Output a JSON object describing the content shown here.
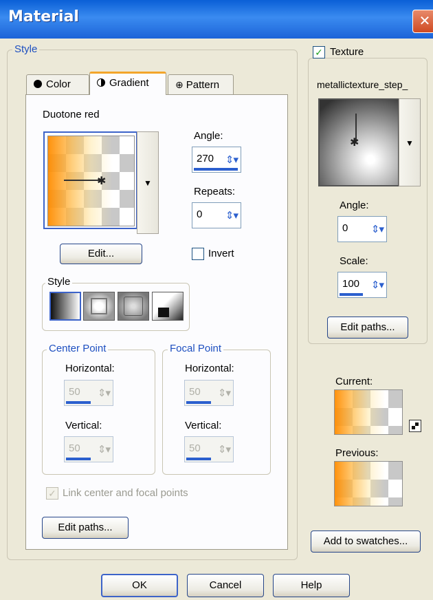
{
  "window": {
    "title": "Material",
    "close_glyph": "✕"
  },
  "style_group": {
    "label": "Style"
  },
  "tabs": [
    {
      "label": "Color",
      "icon": "color-dot-icon"
    },
    {
      "label": "Gradient",
      "icon": "gradient-half-icon"
    },
    {
      "label": "Pattern",
      "icon": "pattern-icon"
    }
  ],
  "gradient": {
    "name": "Duotone red",
    "angle_label": "Angle:",
    "angle_value": "270",
    "repeats_label": "Repeats:",
    "repeats_value": "0",
    "edit_button": "Edit...",
    "invert_label": "Invert",
    "invert_checked": false,
    "style_label": "Style",
    "style_options": [
      "linear",
      "rectangular",
      "sunburst",
      "radial"
    ],
    "center_point": {
      "label": "Center Point",
      "horizontal_label": "Horizontal:",
      "horizontal_value": "50",
      "vertical_label": "Vertical:",
      "vertical_value": "50"
    },
    "focal_point": {
      "label": "Focal Point",
      "horizontal_label": "Horizontal:",
      "horizontal_value": "50",
      "vertical_label": "Vertical:",
      "vertical_value": "50"
    },
    "link_label": "Link center and focal points",
    "link_checked": true,
    "edit_paths_button": "Edit paths..."
  },
  "texture": {
    "label": "Texture",
    "checked": true,
    "name": "metallictexture_step_",
    "angle_label": "Angle:",
    "angle_value": "0",
    "scale_label": "Scale:",
    "scale_value": "100",
    "edit_paths_button": "Edit paths..."
  },
  "preview": {
    "current_label": "Current:",
    "previous_label": "Previous:",
    "add_swatches_button": "Add to swatches..."
  },
  "footer": {
    "ok": "OK",
    "cancel": "Cancel",
    "help": "Help"
  },
  "spin_arrows": "⇕▾",
  "check_glyph": "✓"
}
